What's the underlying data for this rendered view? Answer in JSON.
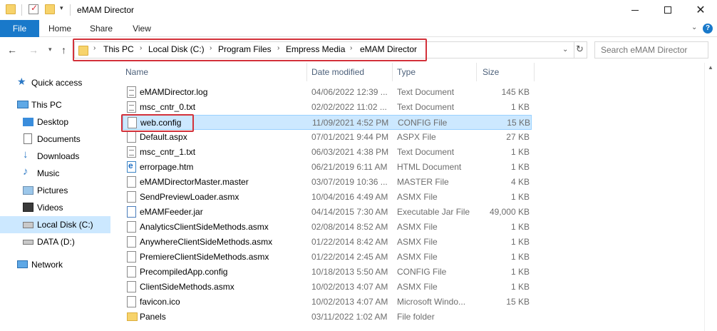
{
  "window": {
    "title": "eMAM Director"
  },
  "ribbon": {
    "tabs": [
      "File",
      "Home",
      "Share",
      "View"
    ]
  },
  "address": {
    "crumbs": [
      "This PC",
      "Local Disk (C:)",
      "Program Files",
      "Empress Media",
      "eMAM Director"
    ]
  },
  "search": {
    "placeholder": "Search eMAM Director"
  },
  "sidebar": {
    "quick_access": "Quick access",
    "this_pc": "This PC",
    "desktop": "Desktop",
    "documents": "Documents",
    "downloads": "Downloads",
    "music": "Music",
    "pictures": "Pictures",
    "videos": "Videos",
    "local_disk": "Local Disk (C:)",
    "data": "DATA (D:)",
    "network": "Network"
  },
  "columns": {
    "name": "Name",
    "date": "Date modified",
    "type": "Type",
    "size": "Size"
  },
  "files": [
    {
      "name": "eMAMDirector.log",
      "date": "04/06/2022 12:39 ...",
      "type": "Text Document",
      "size": "145 KB",
      "icon": "txt"
    },
    {
      "name": "msc_cntr_0.txt",
      "date": "02/02/2022 11:02 ...",
      "type": "Text Document",
      "size": "1 KB",
      "icon": "txt"
    },
    {
      "name": "web.config",
      "date": "11/09/2021 4:52 PM",
      "type": "CONFIG File",
      "size": "15 KB",
      "icon": "file"
    },
    {
      "name": "Default.aspx",
      "date": "07/01/2021 9:44 PM",
      "type": "ASPX File",
      "size": "27 KB",
      "icon": "file"
    },
    {
      "name": "msc_cntr_1.txt",
      "date": "06/03/2021 4:38 PM",
      "type": "Text Document",
      "size": "1 KB",
      "icon": "txt"
    },
    {
      "name": "errorpage.htm",
      "date": "06/21/2019 6:11 AM",
      "type": "HTML Document",
      "size": "1 KB",
      "icon": "htm"
    },
    {
      "name": "eMAMDirectorMaster.master",
      "date": "03/07/2019 10:36 ...",
      "type": "MASTER File",
      "size": "4 KB",
      "icon": "file"
    },
    {
      "name": "SendPreviewLoader.asmx",
      "date": "10/04/2016 4:49 AM",
      "type": "ASMX File",
      "size": "1 KB",
      "icon": "file"
    },
    {
      "name": "eMAMFeeder.jar",
      "date": "04/14/2015 7:30 AM",
      "type": "Executable Jar File",
      "size": "49,000 KB",
      "icon": "jar"
    },
    {
      "name": "AnalyticsClientSideMethods.asmx",
      "date": "02/08/2014 8:52 AM",
      "type": "ASMX File",
      "size": "1 KB",
      "icon": "file"
    },
    {
      "name": "AnywhereClientSideMethods.asmx",
      "date": "01/22/2014 8:42 AM",
      "type": "ASMX File",
      "size": "1 KB",
      "icon": "file"
    },
    {
      "name": "PremiereClientSideMethods.asmx",
      "date": "01/22/2014 2:45 AM",
      "type": "ASMX File",
      "size": "1 KB",
      "icon": "file"
    },
    {
      "name": "PrecompiledApp.config",
      "date": "10/18/2013 5:50 AM",
      "type": "CONFIG File",
      "size": "1 KB",
      "icon": "file"
    },
    {
      "name": "ClientSideMethods.asmx",
      "date": "10/02/2013 4:07 AM",
      "type": "ASMX File",
      "size": "1 KB",
      "icon": "file"
    },
    {
      "name": "favicon.ico",
      "date": "10/02/2013 4:07 AM",
      "type": "Microsoft Windo...",
      "size": "15 KB",
      "icon": "file"
    },
    {
      "name": "Panels",
      "date": "03/11/2022 1:02 AM",
      "type": "File folder",
      "size": "",
      "icon": "folder"
    }
  ]
}
